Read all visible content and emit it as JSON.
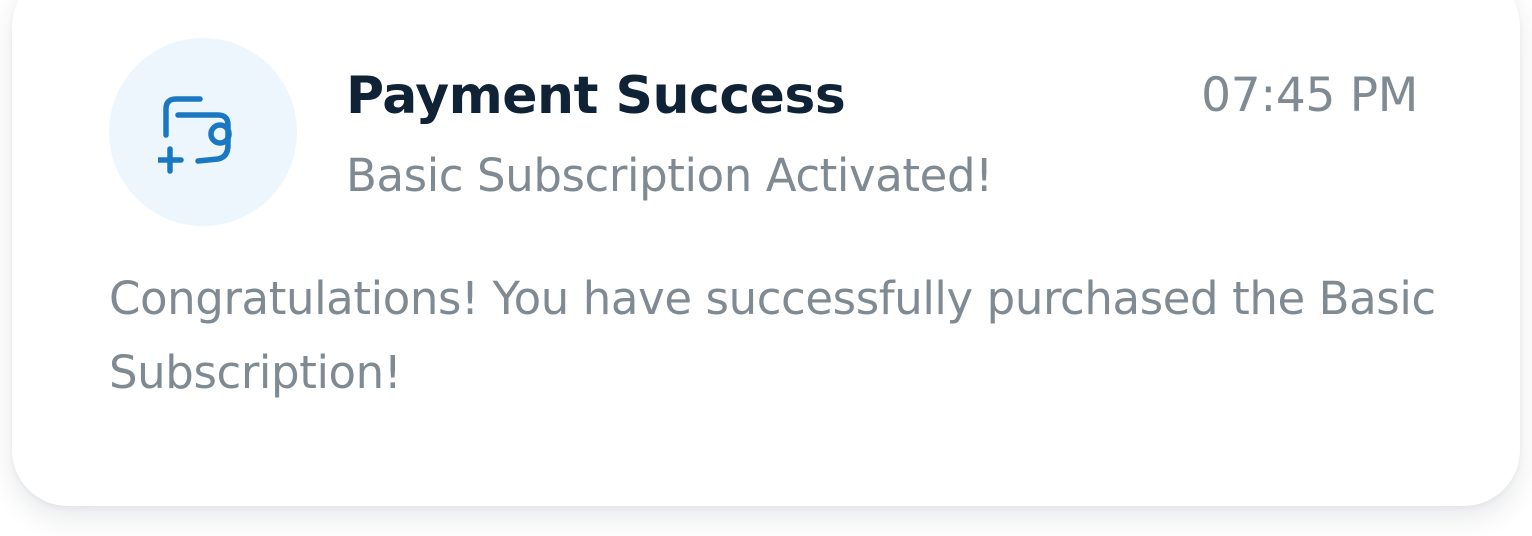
{
  "notification": {
    "icon": "payment-wallet-icon",
    "accent_color": "#1a78c2",
    "title": "Payment Success",
    "time": "07:45 PM",
    "subtitle": "Basic Subscription Activated!",
    "message": "Congratulations! You have successfully purchased the Basic Subscription!"
  }
}
